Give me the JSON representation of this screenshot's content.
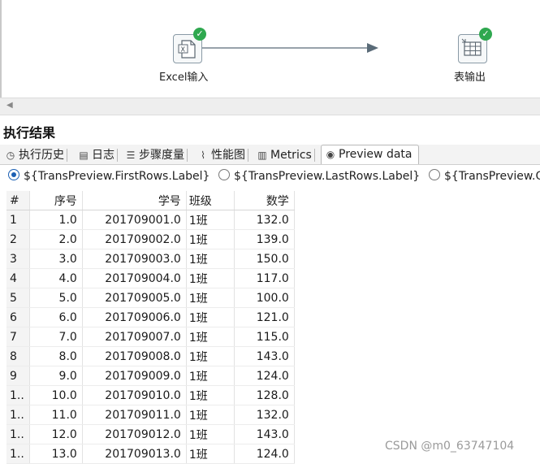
{
  "canvas": {
    "steps": [
      {
        "label": "Excel输入",
        "icon": "excel-file-icon",
        "status": "success"
      },
      {
        "label": "表输出",
        "icon": "table-output-icon",
        "status": "success"
      }
    ]
  },
  "results": {
    "title": "执行结果",
    "tabs": [
      {
        "label": "执行历史",
        "icon": "history-clock-icon"
      },
      {
        "label": "日志",
        "icon": "log-document-icon"
      },
      {
        "label": "步骤度量",
        "icon": "step-metrics-icon"
      },
      {
        "label": "性能图",
        "icon": "performance-chart-icon"
      },
      {
        "label": "Metrics",
        "icon": "metrics-icon"
      },
      {
        "label": "Preview data",
        "icon": "eye-icon",
        "active": true
      }
    ],
    "preview_options": [
      {
        "label": "${TransPreview.FirstRows.Label}",
        "selected": true
      },
      {
        "label": "${TransPreview.LastRows.Label}",
        "selected": false
      },
      {
        "label": "${TransPreview.O",
        "selected": false
      }
    ],
    "table": {
      "columns": [
        "#",
        "序号",
        "学号",
        "班级",
        "数学"
      ],
      "rows": [
        [
          "1",
          "1.0",
          "201709001.0",
          "1班",
          "132.0"
        ],
        [
          "2",
          "2.0",
          "201709002.0",
          "1班",
          "139.0"
        ],
        [
          "3",
          "3.0",
          "201709003.0",
          "1班",
          "150.0"
        ],
        [
          "4",
          "4.0",
          "201709004.0",
          "1班",
          "117.0"
        ],
        [
          "5",
          "5.0",
          "201709005.0",
          "1班",
          "100.0"
        ],
        [
          "6",
          "6.0",
          "201709006.0",
          "1班",
          "121.0"
        ],
        [
          "7",
          "7.0",
          "201709007.0",
          "1班",
          "115.0"
        ],
        [
          "8",
          "8.0",
          "201709008.0",
          "1班",
          "143.0"
        ],
        [
          "9",
          "9.0",
          "201709009.0",
          "1班",
          "124.0"
        ],
        [
          "1..",
          "10.0",
          "201709010.0",
          "1班",
          "128.0"
        ],
        [
          "1..",
          "11.0",
          "201709011.0",
          "1班",
          "132.0"
        ],
        [
          "1..",
          "12.0",
          "201709012.0",
          "1班",
          "143.0"
        ],
        [
          "1..",
          "13.0",
          "201709013.0",
          "1班",
          "124.0"
        ]
      ]
    }
  },
  "watermark": "CSDN @m0_63747104",
  "colors": {
    "success": "#2fa84f",
    "hop": "#5a6b78",
    "radio_selected": "#1b5fb3"
  }
}
